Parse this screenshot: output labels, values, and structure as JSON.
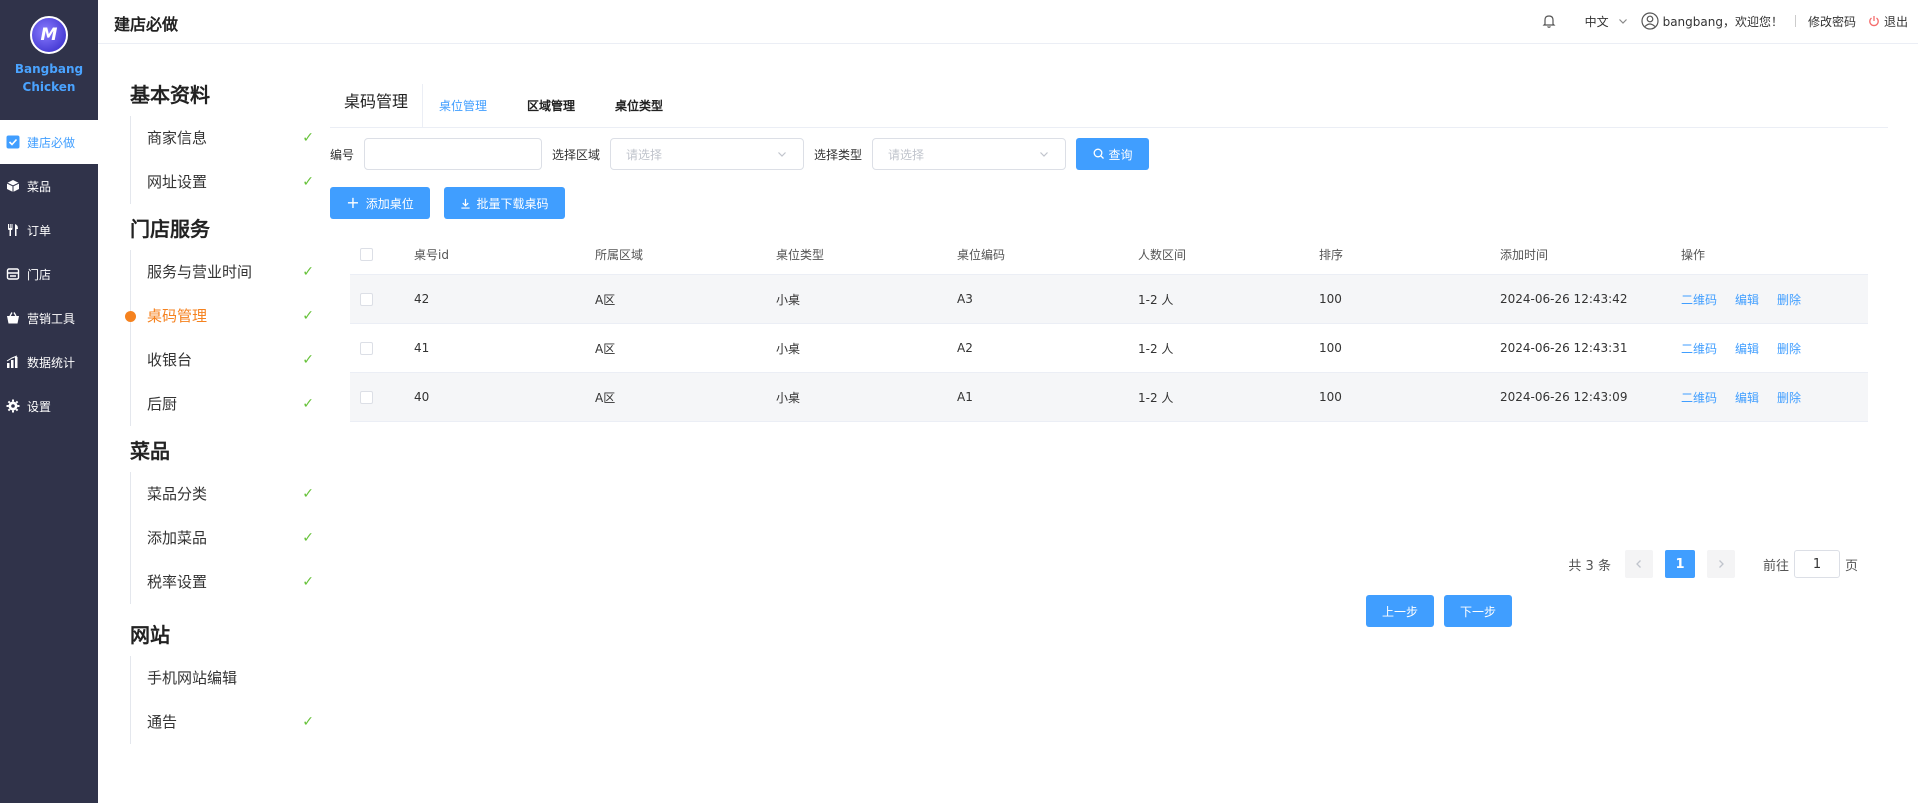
{
  "brand": {
    "logo_letter": "M",
    "line1": "Bangbang",
    "line2": "Chicken"
  },
  "nav": [
    {
      "label": "建店必做",
      "icon": "check-square-icon",
      "active": true
    },
    {
      "label": "菜品",
      "icon": "box-icon"
    },
    {
      "label": "订单",
      "icon": "fork-knife-icon"
    },
    {
      "label": "门店",
      "icon": "store-icon"
    },
    {
      "label": "营销工具",
      "icon": "basket-icon"
    },
    {
      "label": "数据统计",
      "icon": "bar-chart-icon"
    },
    {
      "label": "设置",
      "icon": "gear-icon"
    }
  ],
  "header": {
    "title": "建店必做",
    "lang": "中文",
    "user": "bangbang，欢迎您！",
    "change_password": "修改密码",
    "logout": "退出"
  },
  "steps": [
    {
      "title": "基本资料",
      "items": [
        {
          "label": "商家信息",
          "done": "✓"
        },
        {
          "label": "网址设置",
          "done": "✓"
        }
      ]
    },
    {
      "title": "门店服务",
      "items": [
        {
          "label": "服务与营业时间",
          "done": "✓"
        },
        {
          "label": "桌码管理",
          "done": "✓",
          "active": true
        },
        {
          "label": "收银台",
          "done": "✓"
        },
        {
          "label": "后厨",
          "done": "✓"
        }
      ]
    },
    {
      "title": "菜品",
      "items": [
        {
          "label": "菜品分类",
          "done": "✓"
        },
        {
          "label": "添加菜品",
          "done": "✓"
        },
        {
          "label": "税率设置",
          "done": "✓"
        }
      ]
    },
    {
      "title": "网站",
      "items": [
        {
          "label": "手机网站编辑",
          "done": ""
        },
        {
          "label": "通告",
          "done": "✓"
        }
      ]
    }
  ],
  "main": {
    "title": "桌码管理",
    "tabs": [
      "桌位管理",
      "区域管理",
      "桌位类型"
    ],
    "filter": {
      "code_label": "编号",
      "code_value": "",
      "area_label": "选择区域",
      "area_placeholder": "请选择",
      "type_label": "选择类型",
      "type_placeholder": "请选择",
      "search_btn": "查询"
    },
    "add_btn": "添加桌位",
    "download_btn": "批量下载桌码",
    "table": {
      "columns": [
        "桌号id",
        "所属区域",
        "桌位类型",
        "桌位编码",
        "人数区间",
        "排序",
        "添加时间",
        "操作"
      ],
      "rows": [
        {
          "id": "42",
          "area": "A区",
          "type": "小桌",
          "code": "A3",
          "people": "1-2 人",
          "sort": "100",
          "time": "2024-06-26 12:43:42"
        },
        {
          "id": "41",
          "area": "A区",
          "type": "小桌",
          "code": "A2",
          "people": "1-2 人",
          "sort": "100",
          "time": "2024-06-26 12:43:31"
        },
        {
          "id": "40",
          "area": "A区",
          "type": "小桌",
          "code": "A1",
          "people": "1-2 人",
          "sort": "100",
          "time": "2024-06-26 12:43:09"
        }
      ],
      "ops": [
        "二维码",
        "编辑",
        "删除"
      ]
    },
    "pager": {
      "total": "共 3 条",
      "current": "1",
      "goto_label": "前往",
      "goto_value": "1",
      "page_suffix": "页"
    },
    "prev_btn": "上一步",
    "next_btn": "下一步"
  }
}
